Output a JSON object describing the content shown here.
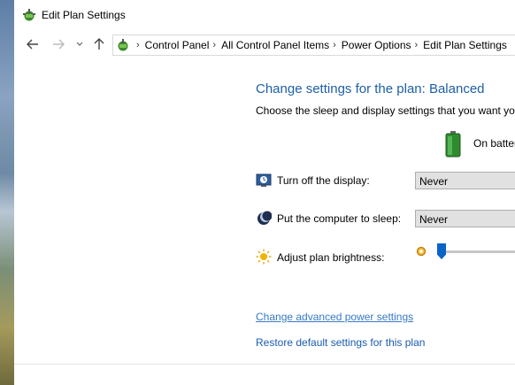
{
  "window": {
    "title": "Edit Plan Settings",
    "icon": "power-plan-icon"
  },
  "nav": {
    "back_icon": "arrow-left-icon",
    "forward_icon": "arrow-right-icon",
    "recent_icon": "chevron-down-icon",
    "up_icon": "arrow-up-icon",
    "breadcrumbs": [
      "Control Panel",
      "All Control Panel Items",
      "Power Options",
      "Edit Plan Settings"
    ]
  },
  "main": {
    "heading": "Change settings for the plan: Balanced",
    "subheading": "Choose the sleep and display settings that you want your computer to use.",
    "column_header": "On battery",
    "rows": [
      {
        "label": "Turn off the display:",
        "value": "Never",
        "icon": "display-icon"
      },
      {
        "label": "Put the computer to sleep:",
        "value": "Never",
        "icon": "sleep-moon-icon"
      },
      {
        "label": "Adjust plan brightness:",
        "icon": "sun-icon",
        "brightness_level": 0.05
      }
    ],
    "links": {
      "advanced": "Change advanced power settings",
      "restore": "Restore default settings for this plan"
    }
  },
  "colors": {
    "heading": "#1e5fa8",
    "link": "#3779c4",
    "slider": "#0a64c8"
  }
}
